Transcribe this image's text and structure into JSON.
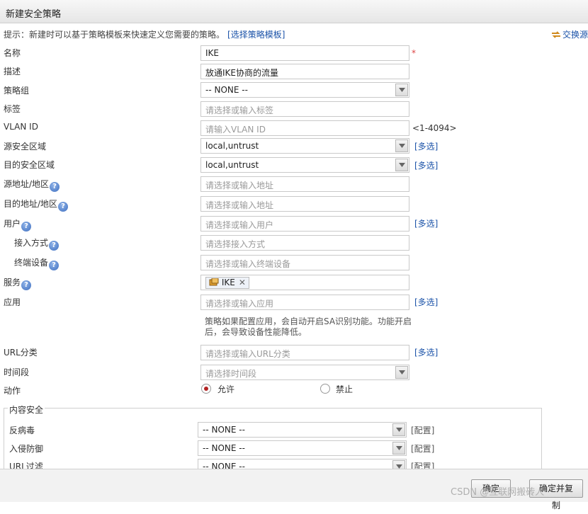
{
  "window": {
    "title": "新建安全策略"
  },
  "hint": {
    "text": "提示：新建时可以基于策略模板来快速定义您需要的策略。",
    "template_link": "[选择策略模板]"
  },
  "swap_link": "交换源",
  "form": {
    "name": {
      "label": "名称",
      "value": "IKE",
      "required": "*"
    },
    "desc": {
      "label": "描述",
      "value": "放通IKE协商的流量"
    },
    "group": {
      "label": "策略组",
      "value": "-- NONE --"
    },
    "tag": {
      "label": "标签",
      "placeholder": "请选择或输入标签"
    },
    "vlan": {
      "label": "VLAN ID",
      "placeholder": "请输入VLAN ID",
      "range": "<1-4094>"
    },
    "src_zone": {
      "label": "源安全区域",
      "value": "local,untrust",
      "multi": "[多选]"
    },
    "dst_zone": {
      "label": "目的安全区域",
      "value": "local,untrust",
      "multi": "[多选]"
    },
    "src_addr": {
      "label": "源地址/地区",
      "placeholder": "请选择或输入地址"
    },
    "dst_addr": {
      "label": "目的地址/地区",
      "placeholder": "请选择或输入地址"
    },
    "user": {
      "label": "用户",
      "placeholder": "请选择或输入用户",
      "multi": "[多选]"
    },
    "access": {
      "label": "接入方式",
      "placeholder": "请选择接入方式"
    },
    "device": {
      "label": "终端设备",
      "placeholder": "请选择或输入终端设备"
    },
    "service": {
      "label": "服务",
      "chip": "IKE",
      "chip_remove": "✕"
    },
    "app": {
      "label": "应用",
      "placeholder": "请选择或输入应用",
      "multi": "[多选]",
      "note": "策略如果配置应用，会自动开启SA识别功能。功能开启后，会导致设备性能降低。"
    },
    "url": {
      "label": "URL分类",
      "placeholder": "请选择或输入URL分类",
      "multi": "[多选]"
    },
    "time": {
      "label": "时间段",
      "placeholder": "请选择时间段"
    },
    "action": {
      "label": "动作",
      "allow": "允许",
      "deny": "禁止",
      "selected": "allow"
    }
  },
  "content_security": {
    "legend": "内容安全",
    "rows": [
      {
        "label": "反病毒",
        "value": "-- NONE --",
        "config": "[配置]"
      },
      {
        "label": "入侵防御",
        "value": "-- NONE --",
        "config": "[配置]"
      },
      {
        "label": "URL过滤",
        "value": "-- NONE --",
        "config": "[配置]"
      }
    ]
  },
  "footer": {
    "ok": "确定",
    "ok_copy": "确定并复制"
  },
  "watermark": "CSDN @互联网搬砖人",
  "colors": {
    "link": "#1a52a8",
    "required": "#d44444",
    "radio_on": "#b22222"
  },
  "help_icon_glyph": "?"
}
